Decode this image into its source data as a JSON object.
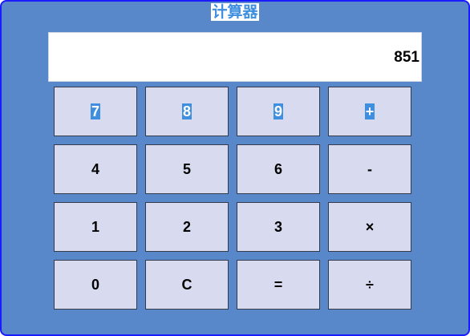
{
  "app": {
    "title": "计算器"
  },
  "display": {
    "value": "851"
  },
  "keys": {
    "row1": [
      "7",
      "8",
      "9",
      "+"
    ],
    "row2": [
      "4",
      "5",
      "6",
      "-"
    ],
    "row3": [
      "1",
      "2",
      "3",
      "×"
    ],
    "row4": [
      "0",
      "C",
      "=",
      "÷"
    ]
  },
  "colors": {
    "panel_background": "#5888c9",
    "frame_border": "#1a1aff",
    "key_background": "#d8dbef",
    "selection_highlight": "#3f8fe0",
    "display_background": "#ffffff"
  }
}
